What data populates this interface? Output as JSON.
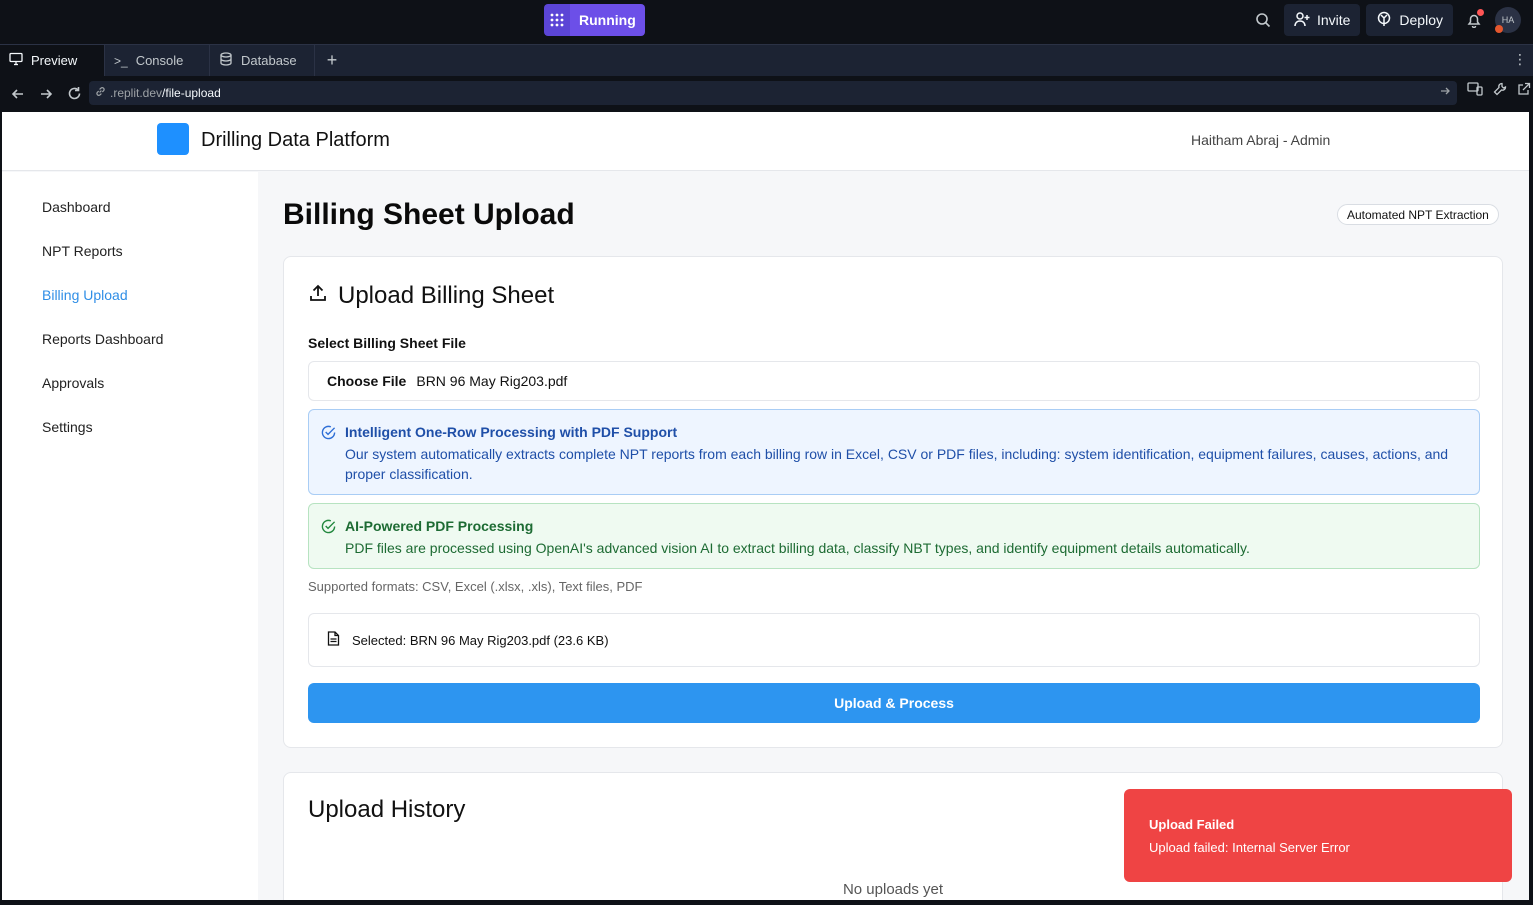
{
  "topbar": {
    "run_status": "Running",
    "invite_label": "Invite",
    "deploy_label": "Deploy",
    "avatar_initials": "HA"
  },
  "tabs": [
    {
      "label": "Preview",
      "icon": "monitor-icon"
    },
    {
      "label": "Console",
      "icon": "terminal-icon"
    },
    {
      "label": "Database",
      "icon": "database-icon"
    }
  ],
  "urlbar": {
    "domain": ".replit.dev",
    "path": "/file-upload"
  },
  "app": {
    "brand": "Drilling Data Platform",
    "user": "Haitham Abraj - Admin",
    "nav": [
      "Dashboard",
      "NPT Reports",
      "Billing Upload",
      "Reports Dashboard",
      "Approvals",
      "Settings"
    ],
    "active_nav": "Billing Upload",
    "page_title": "Billing Sheet Upload",
    "badge": "Automated NPT Extraction",
    "upload_card": {
      "title": "Upload Billing Sheet",
      "field_label": "Select Billing Sheet File",
      "choose_file": "Choose File",
      "file_name": "BRN 96 May Rig203.pdf",
      "info_title": "Intelligent One-Row Processing with PDF Support",
      "info_body": "Our system automatically extracts complete NPT reports from each billing row in Excel, CSV or PDF files, including: system identification, equipment failures, causes, actions, and proper classification.",
      "ai_title": "AI-Powered PDF Processing",
      "ai_body": "PDF files are processed using OpenAI's advanced vision AI to extract billing data, classify NBT types, and identify equipment details automatically.",
      "formats": "Supported formats: CSV, Excel (.xlsx, .xls), Text files, PDF",
      "selected": "Selected: BRN 96 May Rig203.pdf (23.6 KB)",
      "upload_button": "Upload & Process"
    },
    "history": {
      "title": "Upload History",
      "empty": "No uploads yet"
    },
    "toast": {
      "title": "Upload Failed",
      "message": "Upload failed: Internal Server Error"
    }
  },
  "colors": {
    "accent": "#2d95f0",
    "running": "#6c4fe8",
    "error": "#ef4444"
  }
}
